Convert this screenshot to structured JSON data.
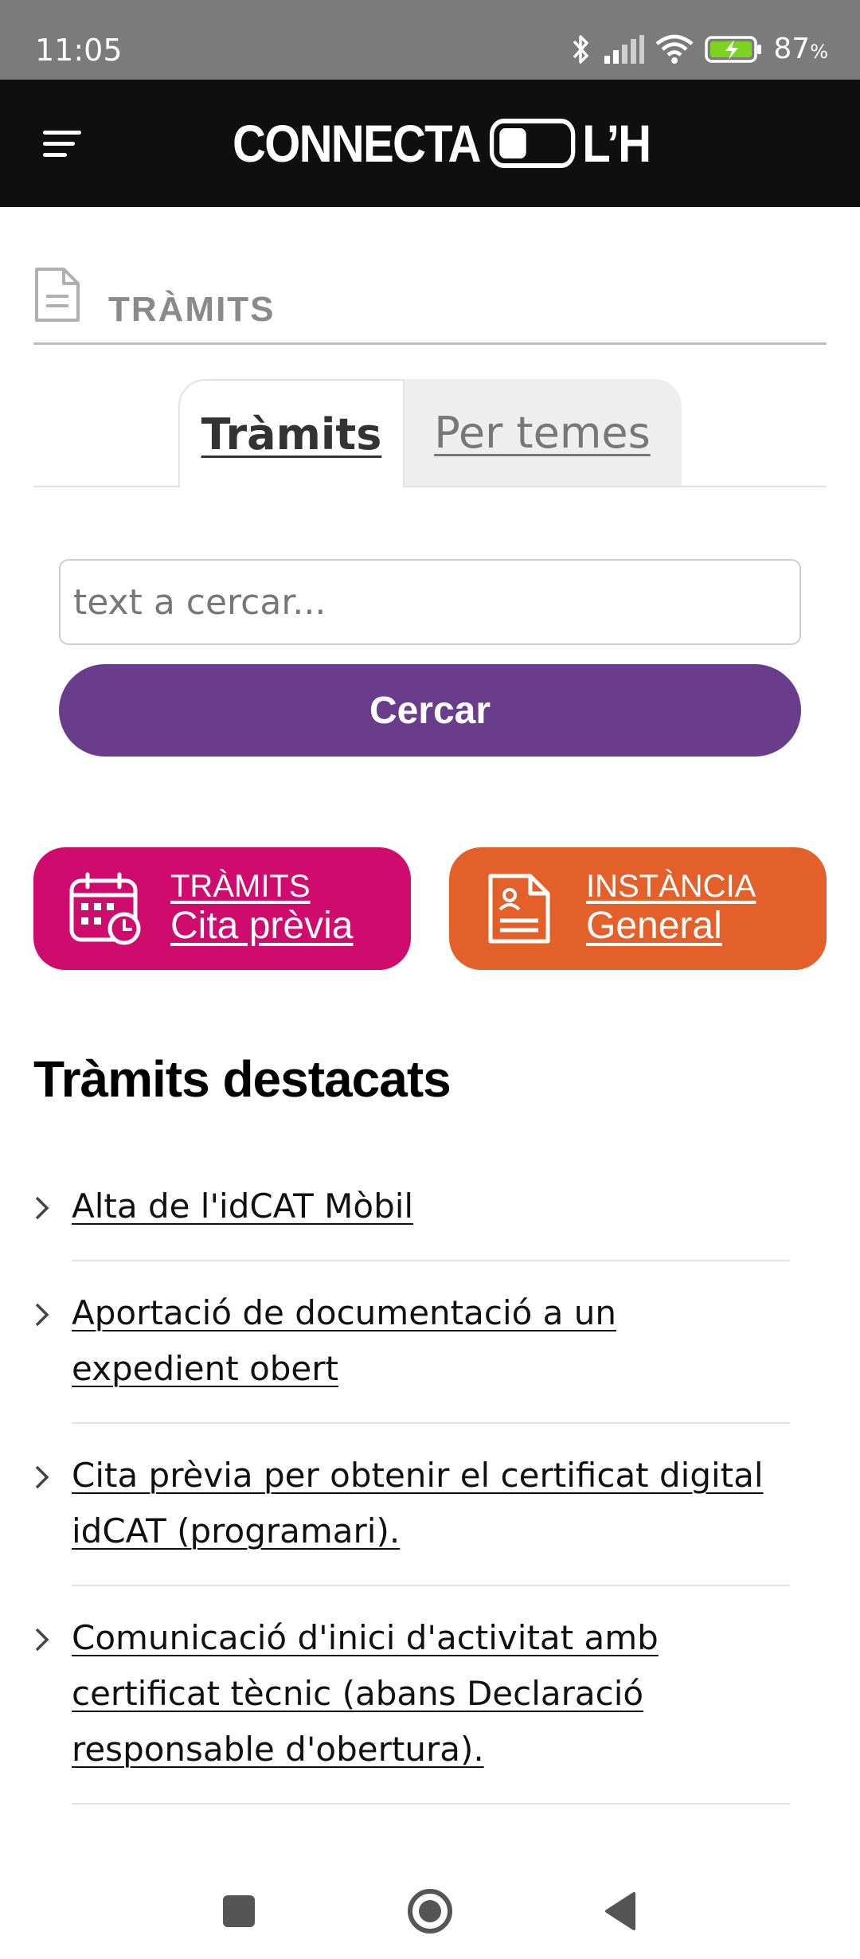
{
  "status_bar": {
    "time": "11:05",
    "battery": "87",
    "battery_unit": "%",
    "icons": [
      "bluetooth-icon",
      "signal-icon",
      "wifi-icon",
      "battery-charging-icon"
    ]
  },
  "header": {
    "brand_left": "CONNECTA",
    "brand_right": "L’H",
    "menu_icon": "menu-icon"
  },
  "section": {
    "title": "TRÀMITS",
    "icon": "document-icon"
  },
  "tabs": [
    {
      "label": "Tràmits",
      "active": true
    },
    {
      "label": "Per temes",
      "active": false
    }
  ],
  "search": {
    "placeholder": "text a cercar...",
    "value": "",
    "button_label": "Cercar"
  },
  "quick_links": [
    {
      "top": "TRÀMITS",
      "bottom": "Cita prèvia",
      "icon": "calendar-clock-icon",
      "color": "#cf0b6e"
    },
    {
      "top": "INSTÀNCIA",
      "bottom": "General",
      "icon": "form-document-icon",
      "color": "#e4602b"
    }
  ],
  "highlighted": {
    "title": "Tràmits destacats",
    "items": [
      "Alta de l'idCAT Mòbil",
      "Aportació de documentació a un expedient obert",
      "Cita prèvia per obtenir el certificat digital idCAT (programari).",
      "Comunicació d'inici d'activitat amb certificat tècnic (abans Declaració responsable d'obertura)."
    ]
  },
  "colors": {
    "accent_purple": "#6a3d8c",
    "magenta": "#cf0b6e",
    "orange": "#e4602b",
    "header_bg": "#0f0f0f"
  }
}
